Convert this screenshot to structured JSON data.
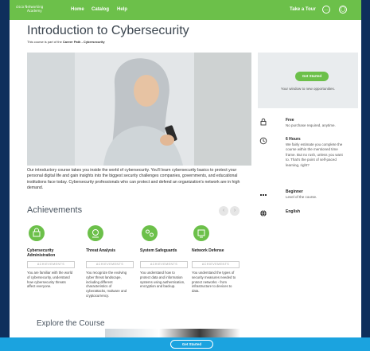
{
  "nav": {
    "logo_line1": "Networking",
    "logo_line2": "Academy",
    "logo_brand": "cisco",
    "links": [
      "Home",
      "Catalog",
      "Help"
    ],
    "take_tour": "Take a Tour",
    "icons": [
      "chat-icon",
      "user-avatar-icon"
    ]
  },
  "course": {
    "title": "Introduction to Cybersecurity",
    "subtitle_prefix": "This course is part of the ",
    "subtitle_path": "Career Path - Cybersecurity",
    "description": "Our introductory course takes you inside the world of cybersecurity. You'll learn cybersecurity basics to protect your personal digital life and gain insights into the biggest security challenges companies, governments, and educational institutions face today. Cybersecurity professionals who can protect and defend an organization's network are in high demand."
  },
  "card": {
    "button": "Get Started",
    "tagline": "Your window to new opportunities.",
    "rows": [
      {
        "icon": "lock-icon",
        "title": "Free",
        "sub": "No purchase required, anytime."
      },
      {
        "icon": "clock-icon",
        "title": "6 Hours",
        "sub": "We fairly estimate you complete the course within the mentioned time frame. But no rush, unless you want to. That's the point of self-paced learning, right?"
      },
      {
        "icon": "level-bars-icon",
        "title": "Beginner",
        "sub": "Level of the course."
      },
      {
        "icon": "globe-icon",
        "title": "English",
        "sub": ""
      }
    ]
  },
  "achievements": {
    "heading": "Achievements",
    "tag": "ACHIEVEMENTS",
    "items": [
      {
        "icon": "shield-lock-icon",
        "title": "Cybersecurity Administration",
        "desc": "You are familiar with the world of cybersecurity, understand how cybersecurity threats affect everyone."
      },
      {
        "icon": "threat-analysis-icon",
        "title": "Threat Analysis",
        "desc": "You recognize the evolving cyber threat landscape, including different characteristics of cyberattacks, malware and cryptocurrency."
      },
      {
        "icon": "safeguard-icon",
        "title": "System Safeguards",
        "desc": "You understand how to protect data and information systems using authentication, encryption and backup."
      },
      {
        "icon": "network-defense-icon",
        "title": "Network Defense",
        "desc": "You understand the types of security measures needed to protect networks - from infrastructure to devices to data."
      }
    ]
  },
  "explore": {
    "heading": "Explore the Course"
  },
  "footer": {
    "button": "Get Started"
  },
  "colors": {
    "green": "#6cc04a",
    "blue": "#1ba3df",
    "navy": "#0e2f5c"
  }
}
